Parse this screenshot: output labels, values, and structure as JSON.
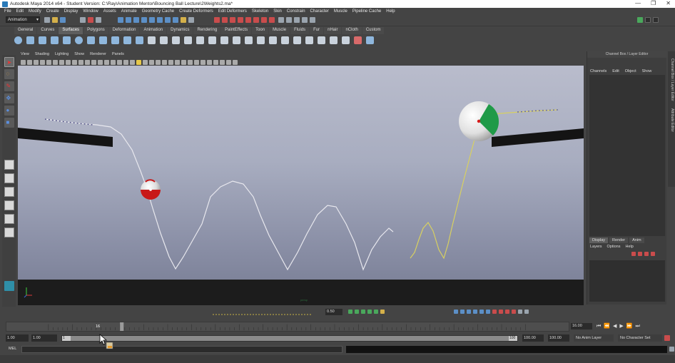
{
  "window": {
    "title": "Autodesk Maya 2014 x64 - Student Version: C:\\Ray\\Animation Mentor\\Bouncing Ball Lecture\\2Weights2.ma*",
    "controls": [
      "—",
      "❐",
      "✕"
    ]
  },
  "menubar": [
    "File",
    "Edit",
    "Modify",
    "Create",
    "Display",
    "Window",
    "Assets",
    "Animate",
    "Geometry Cache",
    "Create Deformers",
    "Edit Deformers",
    "Skeleton",
    "Skin",
    "Constrain",
    "Character",
    "Muscle",
    "Pipeline Cache",
    "Help"
  ],
  "status_line": {
    "mode": "Animation"
  },
  "shelf": {
    "tabs": [
      "General",
      "Curves",
      "Surfaces",
      "Polygons",
      "Deformation",
      "Animation",
      "Dynamics",
      "Rendering",
      "PaintEffects",
      "Toon",
      "Muscle",
      "Fluids",
      "Fur",
      "nHair",
      "nCloth",
      "Custom"
    ],
    "active_tab": "Surfaces"
  },
  "panel": {
    "menu": [
      "View",
      "Shading",
      "Lighting",
      "Show",
      "Renderer",
      "Panels"
    ],
    "camera_label": "persp"
  },
  "channel_box": {
    "title": "Channel Box / Layer Editor",
    "menu": [
      "Channels",
      "Edit",
      "Object",
      "Show"
    ],
    "layer_tabs": [
      "Display",
      "Render",
      "Anim"
    ],
    "active_layer_tab": "Display",
    "layer_menu": [
      "Layers",
      "Options",
      "Help"
    ],
    "side_tabs": [
      "Channel Box / Layer Editor",
      "Attribute Editor"
    ]
  },
  "graph_toolbar": {
    "speed_value": "0.50"
  },
  "time_slider": {
    "current_frame": "16",
    "current_time_field": "16.00",
    "playback_buttons": [
      "⏮",
      "⏪",
      "◀",
      "▶",
      "⏩",
      "⏭"
    ]
  },
  "range_slider": {
    "start_time": "1.00",
    "playback_start": "1.00",
    "handle_left": "1",
    "handle_right": "100",
    "playback_end": "100.00",
    "end_time": "100.00",
    "anim_layer": "No Anim Layer",
    "character_set": "No Character Set"
  },
  "command_line": {
    "label": "MEL"
  },
  "colors": {
    "viewport_top": "#b9bccc",
    "viewport_bottom": "#767b92",
    "motion_trail": "#e8e8ee",
    "motion_trail_yellow": "#d8d060",
    "ball_red": "#c81818",
    "ball_green": "#1f9a48"
  }
}
